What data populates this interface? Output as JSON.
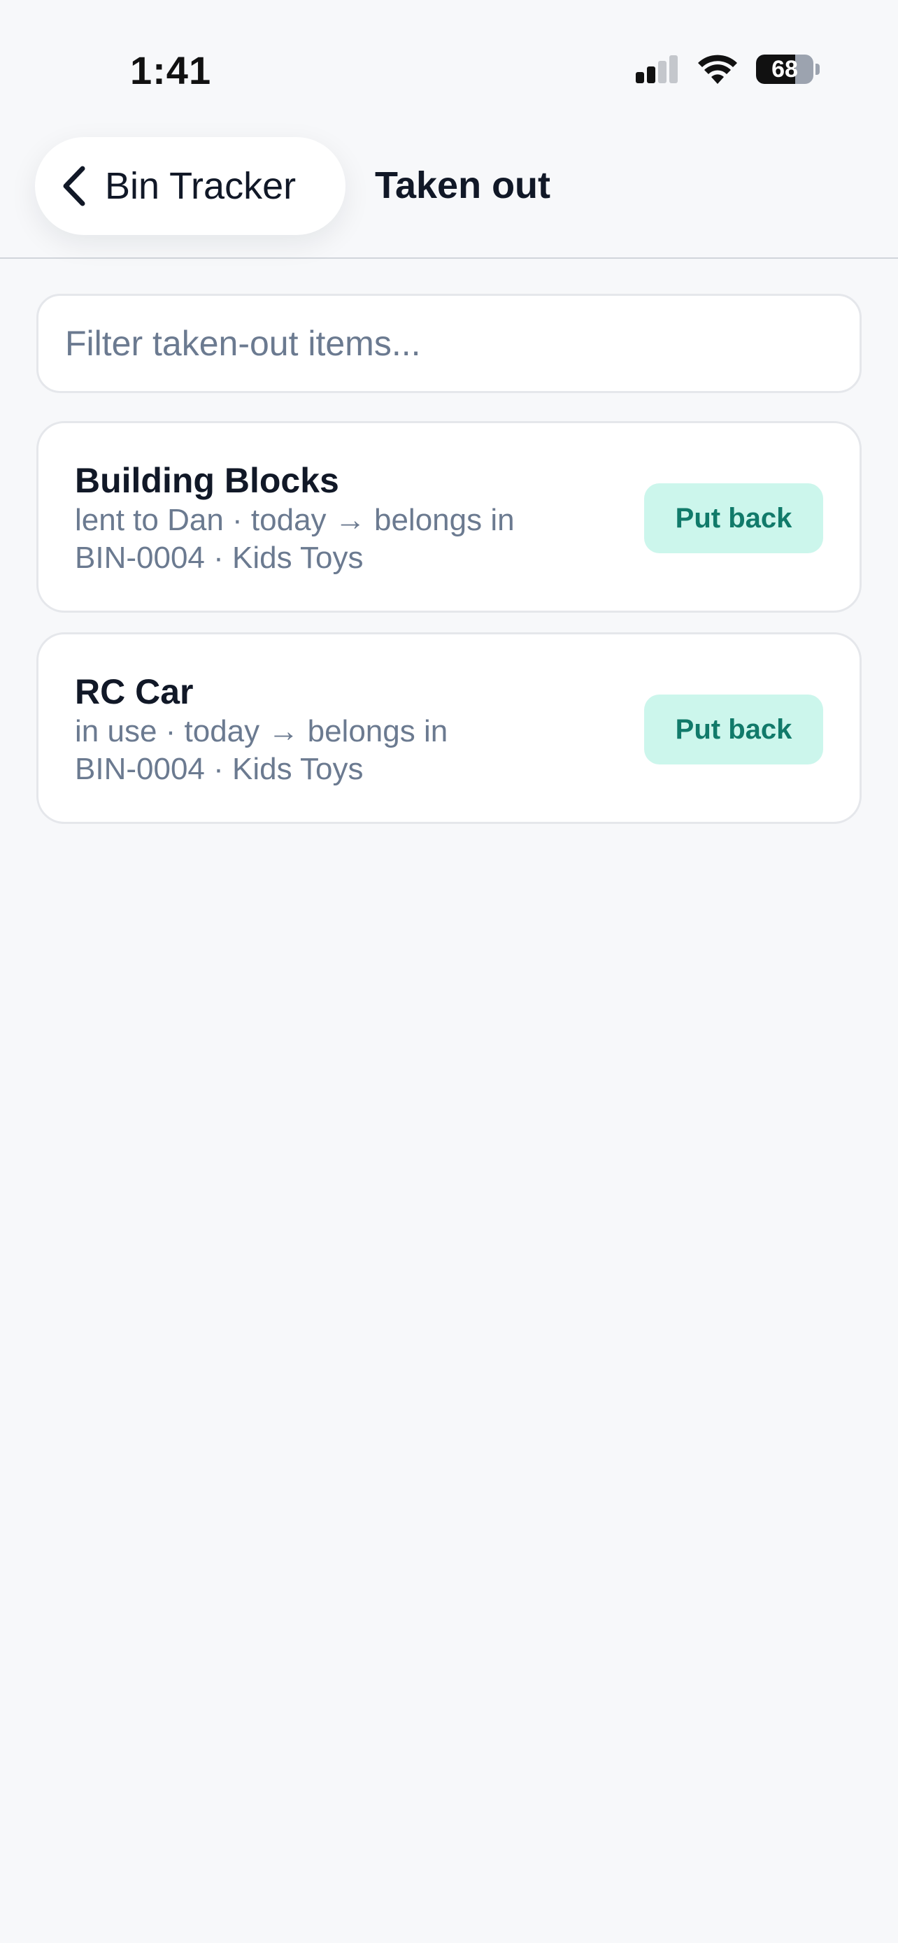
{
  "status_bar": {
    "time": "1:41",
    "battery_level": 68,
    "battery_text": "68",
    "icons": [
      "cellular-signal-icon",
      "wifi-icon",
      "battery-icon"
    ]
  },
  "header": {
    "back_label": "Bin Tracker",
    "back_icon": "chevron-left-icon",
    "title": "Taken out"
  },
  "filter": {
    "placeholder": "Filter taken-out items...",
    "value": ""
  },
  "items": [
    {
      "name": "Building Blocks",
      "status_line": "lent to Dan · today  →  belongs in",
      "location_line": "BIN-0004 · Kids Toys",
      "action_label": "Put back"
    },
    {
      "name": "RC Car",
      "status_line": "in use · today  →  belongs in",
      "location_line": "BIN-0004 · Kids Toys",
      "action_label": "Put back"
    }
  ],
  "colors": {
    "background": "#f7f8fa",
    "text_primary": "#111827",
    "text_secondary": "#6b7a90",
    "accent_bg": "#ccf6ec",
    "accent_text": "#117a6a"
  }
}
